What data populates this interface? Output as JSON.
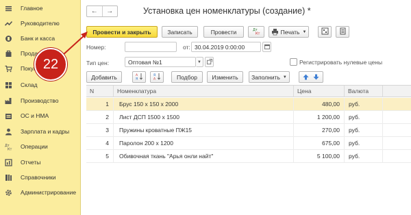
{
  "sidebar": {
    "items": [
      {
        "label": "Главное",
        "icon": "menu-icon"
      },
      {
        "label": "Руководителю",
        "icon": "trend-icon"
      },
      {
        "label": "Банк и касса",
        "icon": "bank-icon"
      },
      {
        "label": "Продажи",
        "icon": "sales-icon"
      },
      {
        "label": "Покупки",
        "icon": "cart-icon"
      },
      {
        "label": "Склад",
        "icon": "warehouse-icon"
      },
      {
        "label": "Производство",
        "icon": "factory-icon"
      },
      {
        "label": "ОС и НМА",
        "icon": "assets-icon"
      },
      {
        "label": "Зарплата и кадры",
        "icon": "person-icon"
      },
      {
        "label": "Операции",
        "icon": "operations-icon"
      },
      {
        "label": "Отчеты",
        "icon": "reports-icon"
      },
      {
        "label": "Справочники",
        "icon": "books-icon"
      },
      {
        "label": "Администрирование",
        "icon": "gear-icon"
      }
    ]
  },
  "header": {
    "back": "←",
    "forward": "→",
    "title": "Установка цен номенклатуры (создание) *"
  },
  "toolbar": {
    "post_and_close": "Провести и закрыть",
    "save": "Записать",
    "post": "Провести",
    "print": "Печать"
  },
  "form": {
    "number_label": "Номер:",
    "number_value": "",
    "date_label": "от:",
    "date_value": "30.04.2019  0:00:00",
    "price_type_label": "Тип цен:",
    "price_type_value": "Оптовая №1",
    "zero_prices_label": "Регистрировать нулевые цены",
    "zero_prices_checked": false
  },
  "table_toolbar": {
    "add": "Добавить",
    "select": "Подбор",
    "change": "Изменить",
    "fill": "Заполнить"
  },
  "table": {
    "headers": [
      "N",
      "Номенклатура",
      "Цена",
      "Валюта"
    ],
    "rows": [
      {
        "n": "1",
        "name": "Брус 150 х 150 х 2000",
        "price": "480,00",
        "currency": "руб."
      },
      {
        "n": "2",
        "name": "Лист ДСП 1500 х 1500",
        "price": "1 200,00",
        "currency": "руб."
      },
      {
        "n": "3",
        "name": "Пружины кроватные ПЖ15",
        "price": "270,00",
        "currency": "руб."
      },
      {
        "n": "4",
        "name": "Паролон 200 х 1200",
        "price": "675,00",
        "currency": "руб."
      },
      {
        "n": "5",
        "name": "Обивочная ткань \"Арья онли найт\"",
        "price": "5 100,00",
        "currency": "руб."
      }
    ]
  },
  "callout": {
    "number": "22",
    "color": "#c8221b"
  },
  "colors": {
    "sidebar_bg": "#fbed9e",
    "primary_button": "#f7d93a",
    "selected_row": "#fbefc4"
  }
}
